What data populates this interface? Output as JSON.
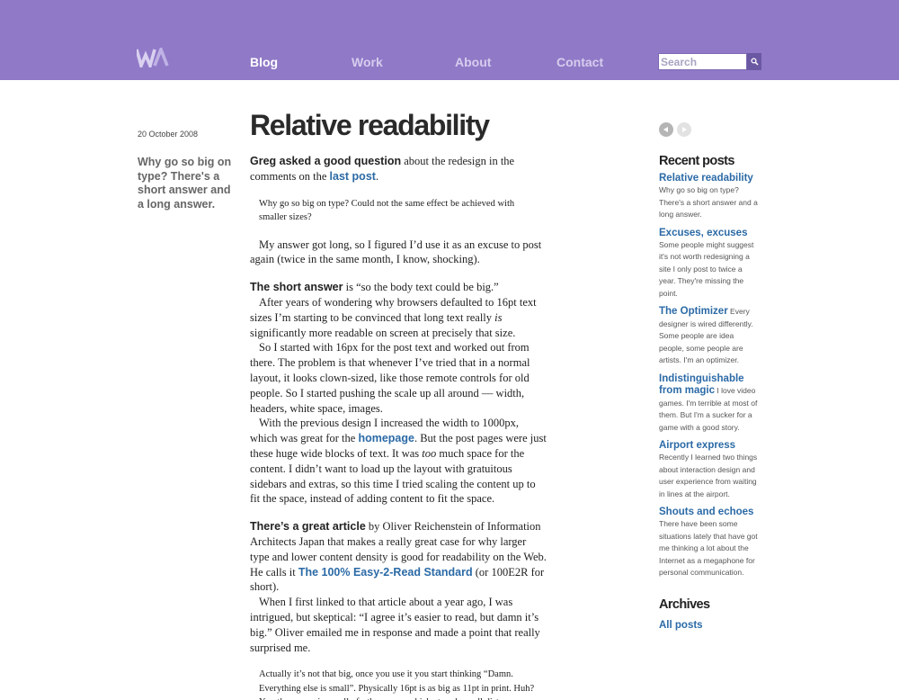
{
  "header": {
    "logo_text": "WA",
    "nav": {
      "blog": "Blog",
      "work": "Work",
      "about": "About",
      "contact": "Contact"
    },
    "search": {
      "placeholder": "Search"
    }
  },
  "post": {
    "date": "20 October 2008",
    "summary": "Why go so big on type? There's a short answer and a long answer.",
    "title": "Relative readability",
    "p1": {
      "lead": "Greg asked a good question",
      "text1": " about the redesign in the comments on the ",
      "link": "last post",
      "text2": "."
    },
    "quote1": "Why go so big on type? Could not the same effect be achieved with smaller sizes?",
    "p2": "My answer got long, so I figured I’d use it as an excuse to post again (twice in the same month, I know, shocking).",
    "p3": {
      "lead": "The short answer",
      "text": " is “so the body text could be big.”"
    },
    "p4": {
      "text1": "After years of wondering why browsers defaulted to 16pt text sizes I’m starting to be convinced that long text really ",
      "em": "is",
      "text2": " significantly more readable on screen at precisely that size."
    },
    "p5": "So I started with 16px for the post text and worked out from there. The problem is that whenever I’ve tried that in a normal layout, it looks clown-sized, like those remote controls for old people. So I started pushing the scale up all around — width, headers, white space, images.",
    "p6": {
      "text1": "With the previous design I increased the width to 1000px, which was great for the ",
      "link": "homepage",
      "text2": ". But the post pages were just these huge wide blocks of text. It was ",
      "em": "too",
      "text3": " much space for the content. I didn’t want to load up the layout with gratuitous sidebars and extras, so this time I tried scaling the content up to fit the space, instead of adding content to fit the space."
    },
    "p7": {
      "lead": "There’s a great article",
      "text1": " by Oliver Reichenstein of Information Architects Japan that makes a really great case for why larger type and lower content density is good for readability on the Web. He calls it ",
      "link": "The 100% Easy-2-Read Standard",
      "text2": " (or 100E2R for short)."
    },
    "p8": "When I first linked to that article about a year ago, I was intrigued, but skeptical: “I agree it’s easier to read, but damn it’s big.” Oliver emailed me in response and made a point that really surprised me.",
    "quote2": "Actually it’s not that big, once you use it you start thinking “Damn. Everything else is small”. Physically 16pt is as big as 11pt in print. Huh? Yes, the screen is usually further away, which at such small distances,"
  },
  "sidebar": {
    "recent_heading": "Recent posts",
    "recent": [
      {
        "title": "Relative readability",
        "desc": "Why go so big on type? There's a short answer and a long answer.",
        "block": true
      },
      {
        "title": "Excuses, excuses",
        "desc": "Some people might suggest it's not worth redesigning a site I only post to twice a year. They're missing the point.",
        "block": true
      },
      {
        "title": "The Optimizer",
        "desc": " Every designer is wired differently. Some people are idea people, some people are artists. I'm an optimizer.",
        "block": false
      },
      {
        "title": "Indistinguishable from magic",
        "desc": " I love video games. I'm terrible at most of them. But I'm a sucker for a game with a good story.",
        "block": false
      },
      {
        "title": "Airport express",
        "desc": "Recently I learned two things about interaction design and user experience from waiting in lines at the airport.",
        "block": true
      },
      {
        "title": "Shouts and echoes",
        "desc": "There have been some situations lately that have got me thinking a lot about the Internet as a megaphone for personal communication.",
        "block": true
      }
    ],
    "archives_heading": "Archives",
    "archives_link": "All posts"
  },
  "colors": {
    "header_bg": "#9079c7",
    "link_blue": "#2b6aa6",
    "nav_active": "#ffffff",
    "nav_inactive": "#d6cdee"
  },
  "icons": {
    "search": "magnifier-icon",
    "prev": "arrow-left-icon",
    "next": "arrow-right-icon"
  }
}
